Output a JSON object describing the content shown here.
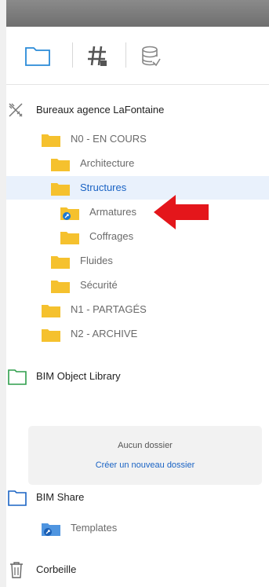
{
  "tree": {
    "project": "Bureaux agence LaFontaine",
    "items": [
      {
        "label": "N0 - EN COURS"
      },
      {
        "label": "Architecture"
      },
      {
        "label": "Structures"
      },
      {
        "label": "Armatures"
      },
      {
        "label": "Coffrages"
      },
      {
        "label": "Fluides"
      },
      {
        "label": "Sécurité"
      },
      {
        "label": "N1 - PARTAGÉS"
      },
      {
        "label": "N2 - ARCHIVE"
      }
    ]
  },
  "library": {
    "title": "BIM Object Library",
    "empty_text": "Aucun dossier",
    "create_link": "Créer un nouveau dossier"
  },
  "share": {
    "title": "BIM Share",
    "templates": "Templates"
  },
  "trash": {
    "title": "Corbeille"
  },
  "colors": {
    "folder": "#f5c12e",
    "selection_bg": "#e9f1fc",
    "link": "#1a63c4",
    "arrow": "#e4161b"
  },
  "icons": [
    "folder-icon",
    "hash-icon",
    "database-icon",
    "tools-icon",
    "shared-folder-icon",
    "trash-icon"
  ]
}
